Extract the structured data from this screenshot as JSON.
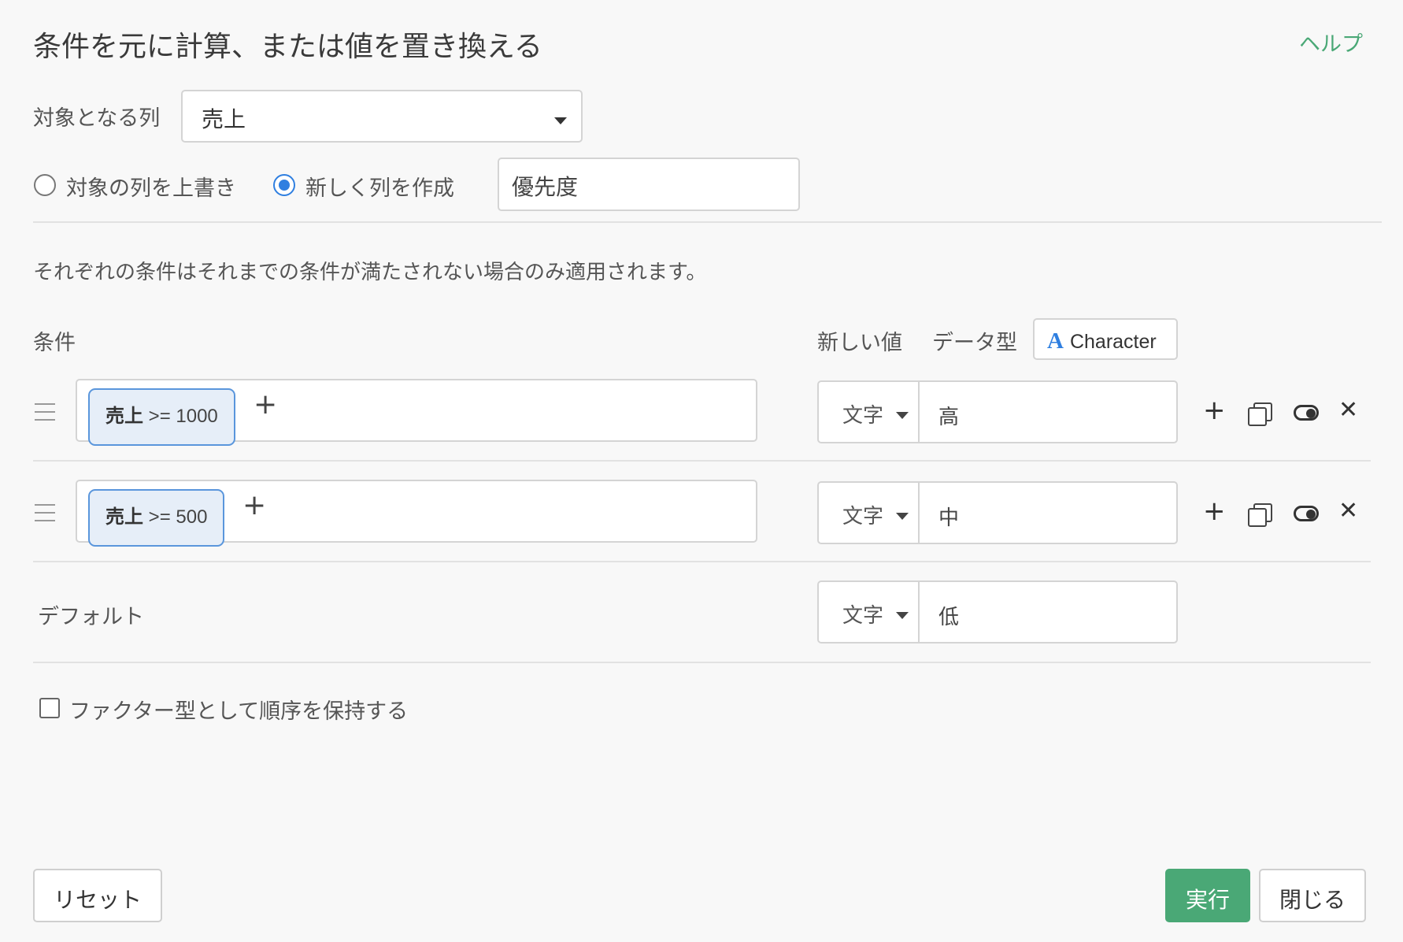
{
  "dialog": {
    "title": "条件を元に計算、または値を置き換える",
    "help_label": "ヘルプ"
  },
  "target_column": {
    "label": "対象となる列",
    "selected": "売上"
  },
  "output_mode": {
    "overwrite_label": "対象の列を上書き",
    "new_column_label": "新しく列を作成",
    "selected": "new_column",
    "new_column_name": "優先度"
  },
  "note": "それぞれの条件はそれまでの条件が満たされない場合のみ適用されます。",
  "headers": {
    "condition": "条件",
    "new_value": "新しい値",
    "data_type": "データ型",
    "data_type_value": "Character",
    "data_type_icon": "A"
  },
  "rules": [
    {
      "condition_column": "売上",
      "condition_expr": ">= 1000",
      "value_type": "文字",
      "value": "高"
    },
    {
      "condition_column": "売上",
      "condition_expr": ">= 500",
      "value_type": "文字",
      "value": "中"
    }
  ],
  "default_row": {
    "label": "デフォルト",
    "value_type": "文字",
    "value": "低"
  },
  "factor_option": {
    "label": "ファクター型として順序を保持する",
    "checked": false
  },
  "footer": {
    "reset_label": "リセット",
    "run_label": "実行",
    "close_label": "閉じる"
  },
  "colors": {
    "accent_green": "#4aa876",
    "accent_blue": "#2f7fe0",
    "pill_bg": "#e6eef8"
  },
  "icons": {
    "add_rule": "plus-icon",
    "duplicate_rule": "copy-icon",
    "toggle_rule": "toggle-icon",
    "delete_rule": "close-icon",
    "drag": "drag-handle-icon"
  }
}
